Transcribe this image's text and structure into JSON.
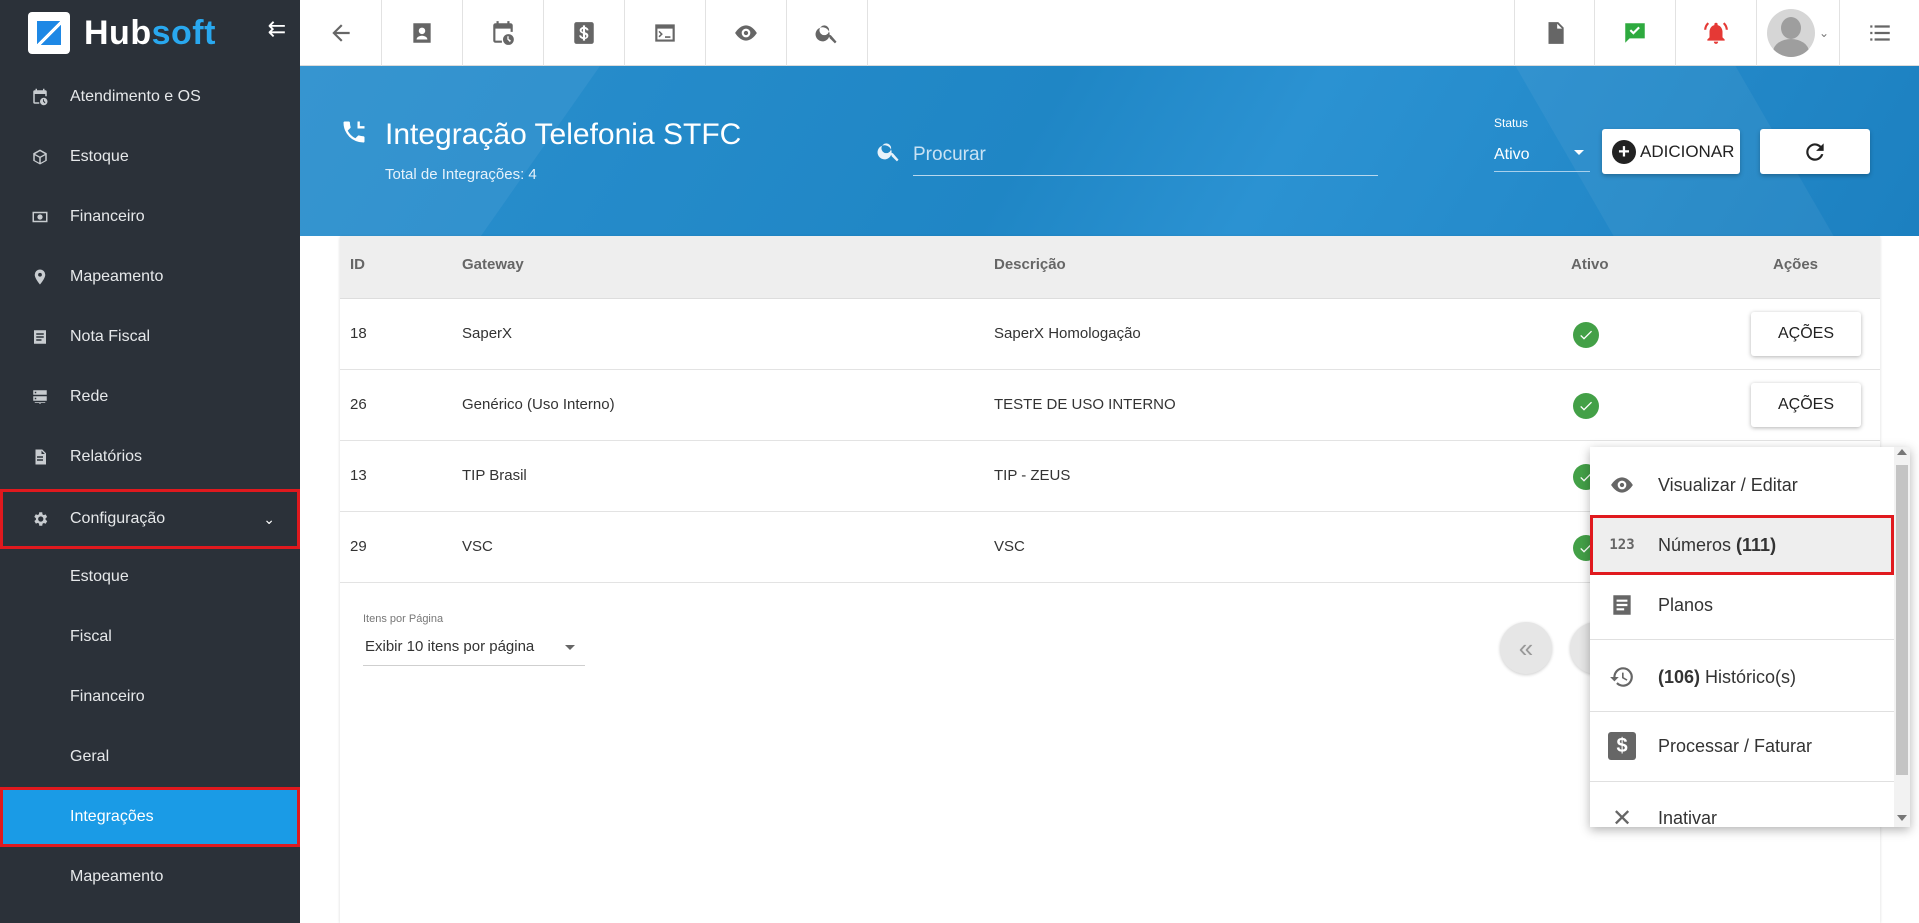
{
  "brand": {
    "hub": "Hub",
    "soft": "soft"
  },
  "sidebar": {
    "items": [
      {
        "label": "Atendimento e OS",
        "icon": "calendar-clock-icon"
      },
      {
        "label": "Estoque",
        "icon": "box-icon"
      },
      {
        "label": "Financeiro",
        "icon": "money-icon"
      },
      {
        "label": "Mapeamento",
        "icon": "map-pin-icon"
      },
      {
        "label": "Nota Fiscal",
        "icon": "receipt-icon"
      },
      {
        "label": "Rede",
        "icon": "server-icon"
      },
      {
        "label": "Relatórios",
        "icon": "document-icon"
      },
      {
        "label": "Configuração",
        "icon": "gear-icon"
      }
    ],
    "sub_items": [
      {
        "label": "Estoque"
      },
      {
        "label": "Fiscal"
      },
      {
        "label": "Financeiro"
      },
      {
        "label": "Geral"
      },
      {
        "label": "Integrações"
      },
      {
        "label": "Mapeamento"
      }
    ]
  },
  "topbar": {
    "left_icons": [
      "back-arrow-icon",
      "contact-card-icon",
      "calendar-clock-icon",
      "dollar-icon",
      "terminal-icon",
      "eye-icon",
      "search-icon"
    ],
    "right_icons": [
      "pdf-icon",
      "chat-check-icon",
      "alarm-bell-icon",
      "user-avatar-icon",
      "list-icon"
    ],
    "colors": {
      "chat": "#2eaa3f",
      "alarm": "#e53935"
    }
  },
  "header": {
    "title": "Integração Telefonia STFC",
    "total": "Total de Integrações: 4",
    "search_placeholder": "Procurar",
    "status_label": "Status",
    "status_value": "Ativo",
    "add_label": "ADICIONAR"
  },
  "table": {
    "columns": [
      "ID",
      "Gateway",
      "Descrição",
      "Ativo",
      "Ações"
    ],
    "rows": [
      {
        "id": "18",
        "gateway": "SaperX",
        "descricao": "SaperX Homologação",
        "ativo": true,
        "acao": "AÇÕES"
      },
      {
        "id": "26",
        "gateway": "Genérico (Uso Interno)",
        "descricao": "TESTE DE USO INTERNO",
        "ativo": true,
        "acao": "AÇÕES"
      },
      {
        "id": "13",
        "gateway": "TIP Brasil",
        "descricao": "TIP - ZEUS",
        "ativo": true
      },
      {
        "id": "29",
        "gateway": "VSC",
        "descricao": "VSC",
        "ativo": true
      }
    ]
  },
  "pagination": {
    "per_page_label": "Itens por Página",
    "per_page_value": "Exibir 10 itens por página",
    "first_label": "«"
  },
  "actions_menu": {
    "items": [
      {
        "label": "Visualizar / Editar",
        "icon": "eye-icon"
      },
      {
        "label_prefix": "Números ",
        "label_bold": "(111)",
        "icon": "numbers-123-icon",
        "icon_text": "123"
      },
      {
        "label": "Planos",
        "icon": "list-doc-icon"
      },
      {
        "label_bold": "(106)",
        "label_suffix": " Histórico(s)",
        "icon": "history-icon"
      },
      {
        "label": "Processar / Faturar",
        "icon": "dollar-icon",
        "icon_text": "$"
      },
      {
        "label": "Inativar",
        "icon": "close-icon"
      }
    ]
  }
}
